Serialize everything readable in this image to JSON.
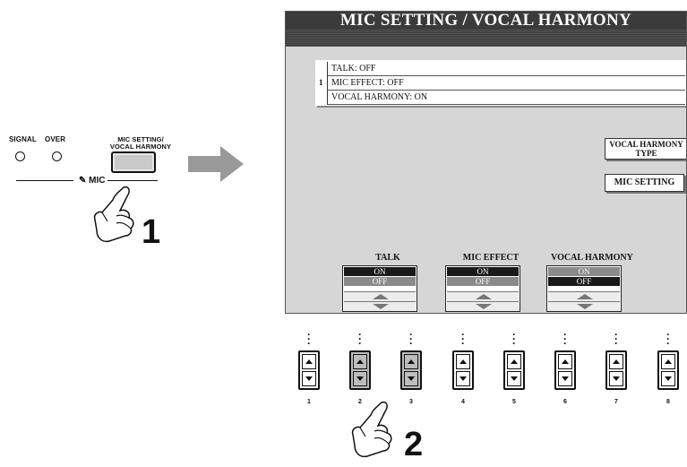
{
  "left_panel": {
    "signal_label": "SIGNAL",
    "over_label": "OVER",
    "button_label_line1": "MIC SETTING/",
    "button_label_line2": "VOCAL HARMONY",
    "mic_label": "MIC",
    "step1": "1"
  },
  "screen": {
    "title": "MIC SETTING / VOCAL HARMONY",
    "list_number": "1",
    "list_rows": [
      "TALK: OFF",
      "MIC EFFECT: OFF",
      "VOCAL HARMONY: ON"
    ],
    "vh_type_line1": "VOCAL HARMONY",
    "vh_type_line2": "TYPE",
    "mic_setting_button": "MIC SETTING",
    "columns": [
      {
        "title": "TALK",
        "on": "ON",
        "off": "OFF",
        "selected": "OFF"
      },
      {
        "title": "MIC EFFECT",
        "on": "ON",
        "off": "OFF",
        "selected": "OFF"
      },
      {
        "title": "VOCAL HARMONY",
        "on": "ON",
        "off": "OFF",
        "selected": "ON"
      }
    ]
  },
  "physical_buttons": {
    "numbers": [
      "1",
      "2",
      "3",
      "4",
      "5",
      "6",
      "7",
      "8"
    ]
  },
  "step2": "2"
}
